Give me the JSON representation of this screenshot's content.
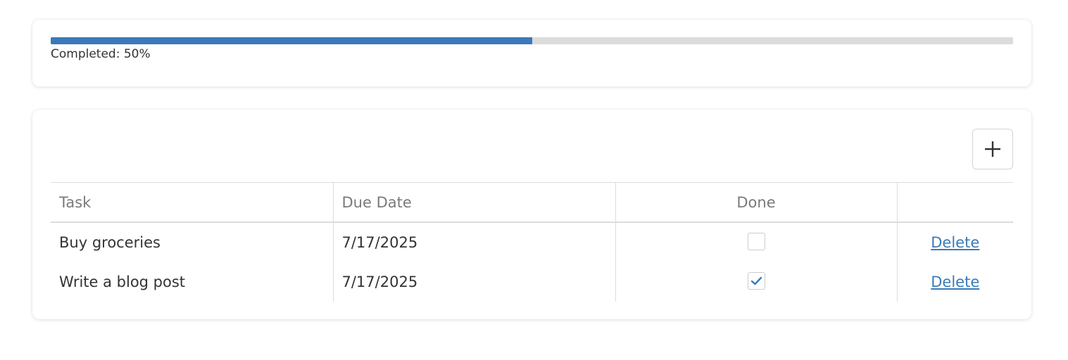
{
  "progress": {
    "fraction": 0.5,
    "label": "Completed: 50%",
    "fill_color": "#3a7ab8",
    "track_color": "#dcdcdc"
  },
  "toolbar": {
    "add_icon": "plus-icon"
  },
  "table": {
    "headers": {
      "task": "Task",
      "due_date": "Due Date",
      "done": "Done",
      "action": ""
    },
    "rows": [
      {
        "task": "Buy groceries",
        "due_date": "7/17/2025",
        "done": false,
        "action": "Delete"
      },
      {
        "task": "Write a blog post",
        "due_date": "7/17/2025",
        "done": true,
        "action": "Delete"
      }
    ]
  },
  "colors": {
    "accent": "#3a7ab8",
    "text": "#333333",
    "header_text": "#7a7a7a",
    "border": "#dcdcdc"
  }
}
